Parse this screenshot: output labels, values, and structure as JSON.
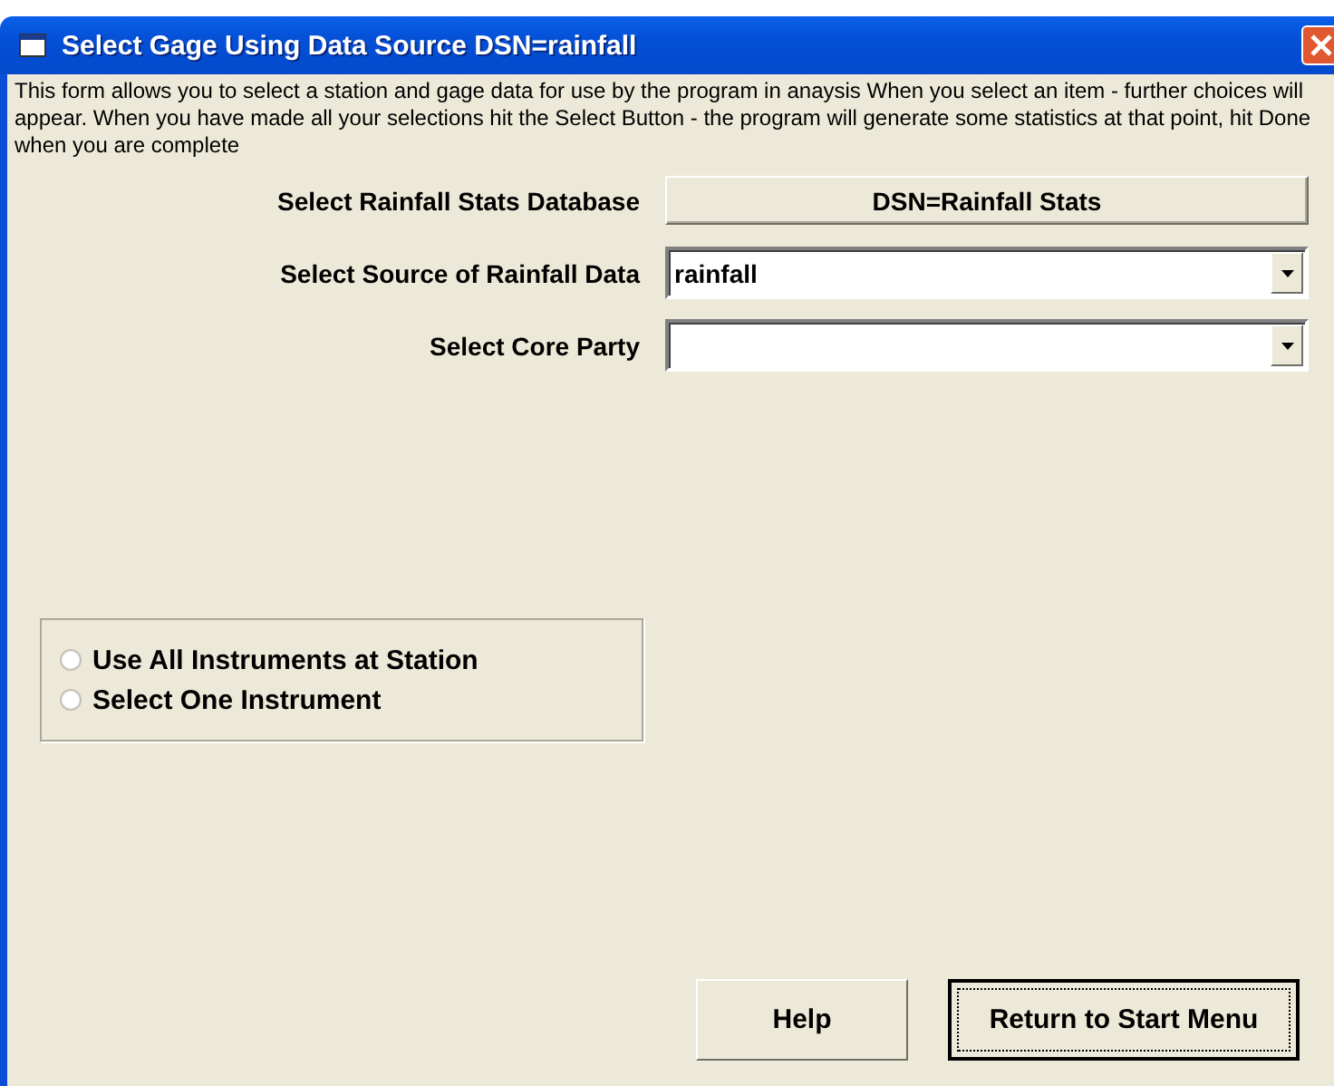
{
  "window": {
    "title": "Select Gage Using Data Source DSN=rainfall"
  },
  "description": "This form allows you to select a station and gage data for use by the program in anaysis When you select an item - further choices will appear. When you have made all your selections hit the Select Button - the program will generate some statistics at that point, hit Done  when you are complete",
  "fields": [
    {
      "kind": "button",
      "label": "Select Rainfall Stats Database",
      "value": "DSN=Rainfall Stats"
    },
    {
      "kind": "combo",
      "label": "Select Source of Rainfall Data",
      "value": "rainfall"
    },
    {
      "kind": "combo",
      "label": "Select Core Party"
    }
  ],
  "instrument_options": [
    {
      "label": "Use All Instruments at Station",
      "selected": false
    },
    {
      "label": "Select One Instrument",
      "selected": false
    }
  ],
  "buttons": [
    {
      "label": "Help",
      "focused": false
    },
    {
      "label": "Return to Start Menu",
      "focused": true
    }
  ]
}
